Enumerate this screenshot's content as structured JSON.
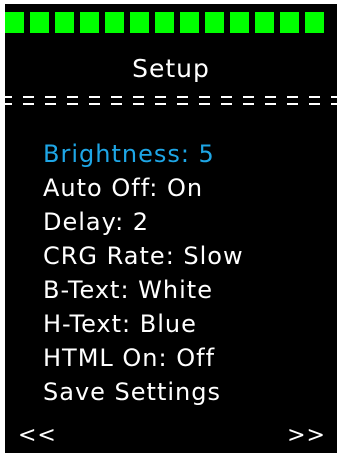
{
  "screen": {
    "title": "Setup",
    "battery_segments": 13,
    "colors": {
      "background": "#000000",
      "battery": "#00ff00",
      "text": "#ffffff",
      "selected": "#1ea6e6"
    }
  },
  "menu": {
    "items": [
      {
        "label": "Brightness: 5",
        "selected": true
      },
      {
        "label": "Auto Off: On",
        "selected": false
      },
      {
        "label": "Delay: 2",
        "selected": false
      },
      {
        "label": "CRG Rate: Slow",
        "selected": false
      },
      {
        "label": "B-Text: White",
        "selected": false
      },
      {
        "label": "H-Text: Blue",
        "selected": false
      },
      {
        "label": "HTML On: Off",
        "selected": false
      },
      {
        "label": "Save Settings",
        "selected": false
      }
    ]
  },
  "nav": {
    "prev_label": "<<",
    "next_label": ">>"
  }
}
